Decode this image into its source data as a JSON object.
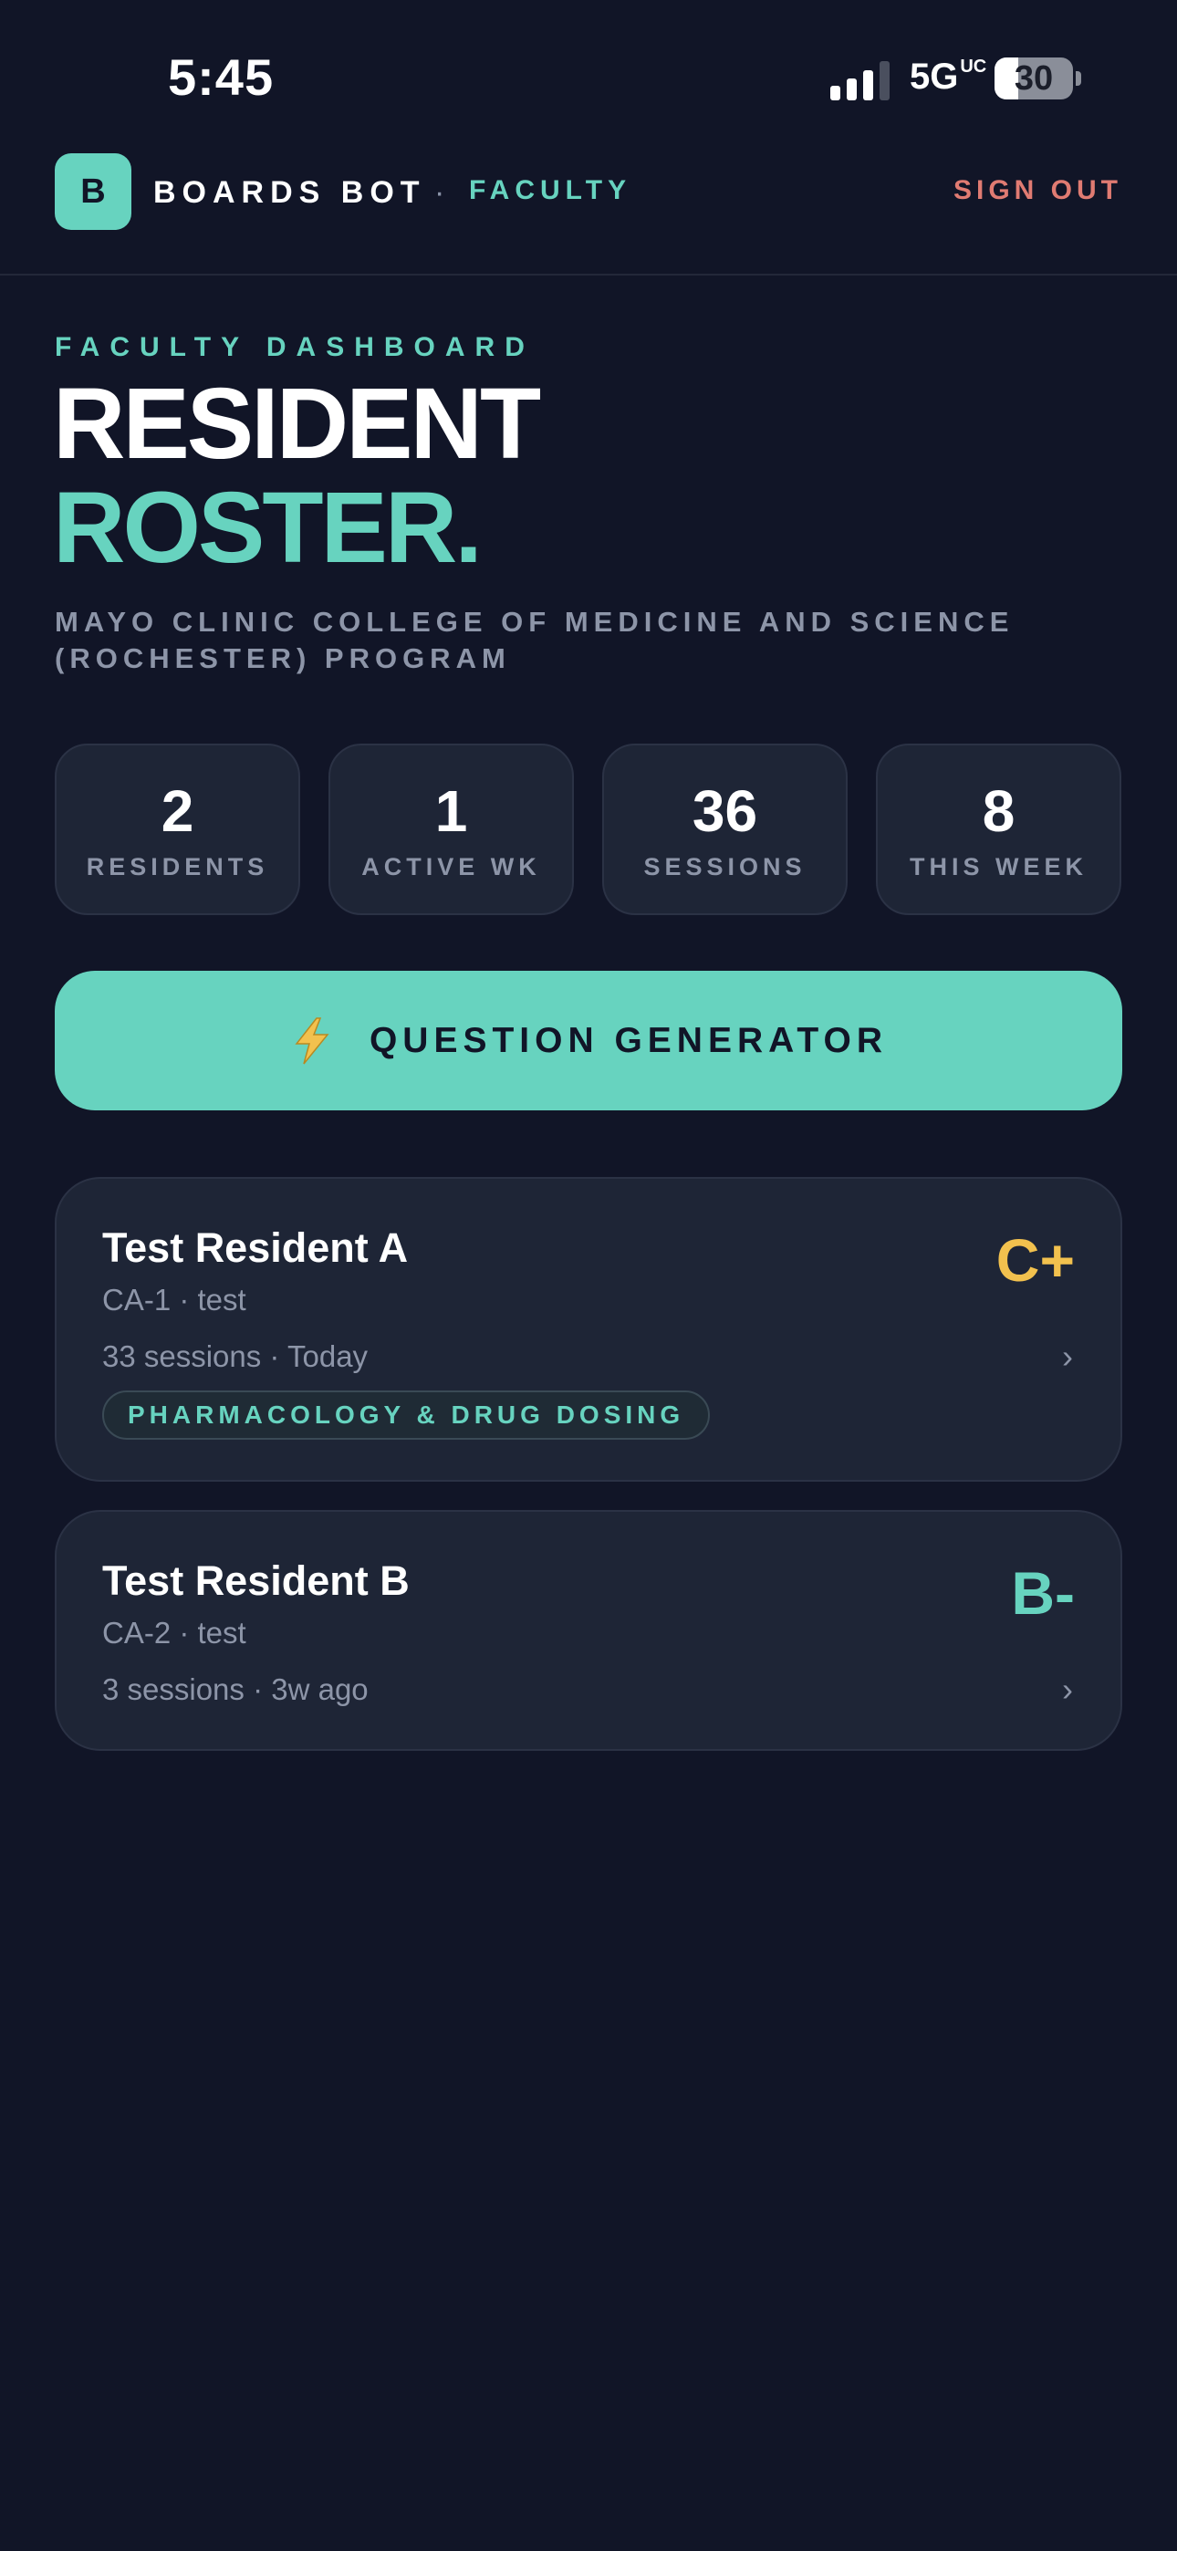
{
  "status_bar": {
    "time": "5:45",
    "network": "5G",
    "network_suffix": "UC",
    "battery": "30",
    "battery_level": 0.3
  },
  "header": {
    "logo_letter": "B",
    "brand": "BOARDS BOT",
    "separator": "·",
    "role": "FACULTY",
    "sign_out": "SIGN OUT"
  },
  "hero": {
    "eyebrow": "FACULTY DASHBOARD",
    "title_line1": "RESIDENT",
    "title_line2": "ROSTER.",
    "program": "MAYO CLINIC COLLEGE OF MEDICINE AND SCIENCE (ROCHESTER) PROGRAM"
  },
  "stats": [
    {
      "value": "2",
      "label": "RESIDENTS"
    },
    {
      "value": "1",
      "label": "ACTIVE WK"
    },
    {
      "value": "36",
      "label": "SESSIONS"
    },
    {
      "value": "8",
      "label": "THIS WEEK"
    }
  ],
  "generator": {
    "label": "QUESTION GENERATOR",
    "icon": "lightning-icon"
  },
  "residents": [
    {
      "name": "Test Resident A",
      "meta": "CA-1 · test",
      "sessions": "33 sessions · Today",
      "grade": "C+",
      "grade_color": "#f2c14e",
      "tag": "PHARMACOLOGY & DRUG DOSING"
    },
    {
      "name": "Test Resident B",
      "meta": "CA-2 · test",
      "sessions": "3 sessions · 3w ago",
      "grade": "B-",
      "grade_color": "#67d3bf"
    }
  ],
  "colors": {
    "background": "#111527",
    "accent": "#67d3bf",
    "danger": "#e07b72",
    "card": "#1e2536",
    "muted": "#8d95a8"
  }
}
